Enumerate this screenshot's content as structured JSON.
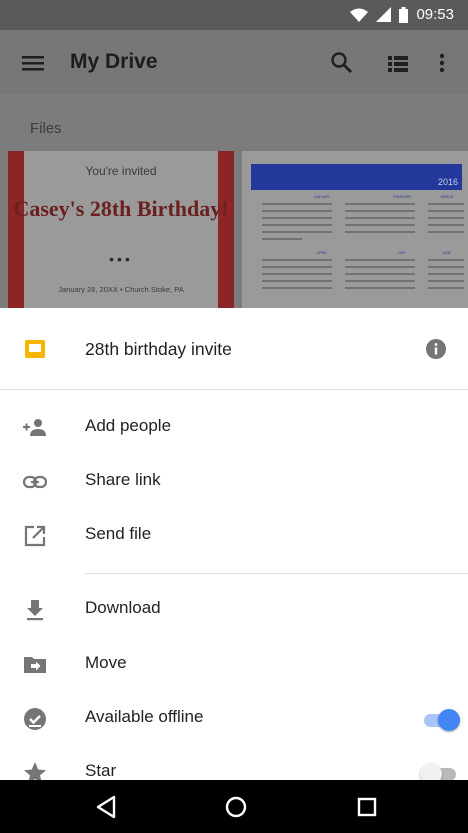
{
  "status_bar": {
    "time": "09:53",
    "icons": [
      "wifi-icon",
      "cell-signal-icon",
      "battery-icon"
    ]
  },
  "app_bar": {
    "title": "My Drive",
    "icons": [
      "menu-icon",
      "search-icon",
      "list-view-icon",
      "more-vert-icon"
    ]
  },
  "content": {
    "section_label": "Files",
    "invite_thumbnail": {
      "invited_text": "You're invited",
      "headline": "Casey's 28th Birthday!",
      "dots": "•••",
      "footer": "January 28, 20XX • Church Stoke, PA"
    },
    "calendar_thumbnail": {
      "year": "2016",
      "months": [
        "JANUARY",
        "FEBRUARY",
        "MARCH",
        "APRIL",
        "MAY",
        "JUNE"
      ]
    }
  },
  "sheet": {
    "file_name": "28th birthday invite",
    "items": [
      {
        "label": "Add people",
        "icon": "add-person-icon"
      },
      {
        "label": "Share link",
        "icon": "link-icon"
      },
      {
        "label": "Send file",
        "icon": "send-file-icon"
      },
      {
        "label": "Download",
        "icon": "download-icon"
      },
      {
        "label": "Move",
        "icon": "move-folder-icon"
      },
      {
        "label": "Available offline",
        "icon": "offline-check-icon",
        "toggle": true,
        "on": true
      },
      {
        "label": "Star",
        "icon": "star-icon",
        "toggle": true,
        "on": false
      }
    ]
  },
  "nav_bar": {
    "icons": [
      "back-icon",
      "home-icon",
      "recents-icon"
    ]
  },
  "colors": {
    "accent": "#4285f4",
    "slides_yellow": "#f4b400",
    "icon_gray": "#757575"
  }
}
